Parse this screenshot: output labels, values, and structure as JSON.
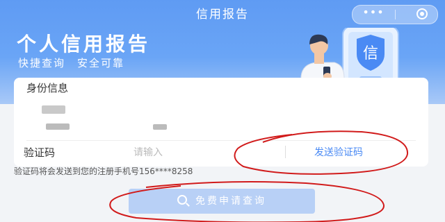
{
  "nav": {
    "title": "信用报告",
    "more": "•••"
  },
  "hero": {
    "title": "个人信用报告",
    "subtitle": "快捷查询　安全可靠",
    "shield_char": "信"
  },
  "identity": {
    "section_title": "身份信息"
  },
  "verification": {
    "label": "验证码",
    "placeholder": "请输入",
    "send_label": "发送验证码",
    "note": "验证码将会发送到您的注册手机号156****8258"
  },
  "action": {
    "query_label": "免费申请查询"
  },
  "colors": {
    "brand": "#5f9bf3",
    "link": "#4a8af4",
    "button_disabled": "#b8d0f6",
    "annotation_ink": "#d11a1a"
  },
  "icons": [
    "more-icon",
    "close-circle-icon",
    "shield-icon",
    "search-icon"
  ]
}
